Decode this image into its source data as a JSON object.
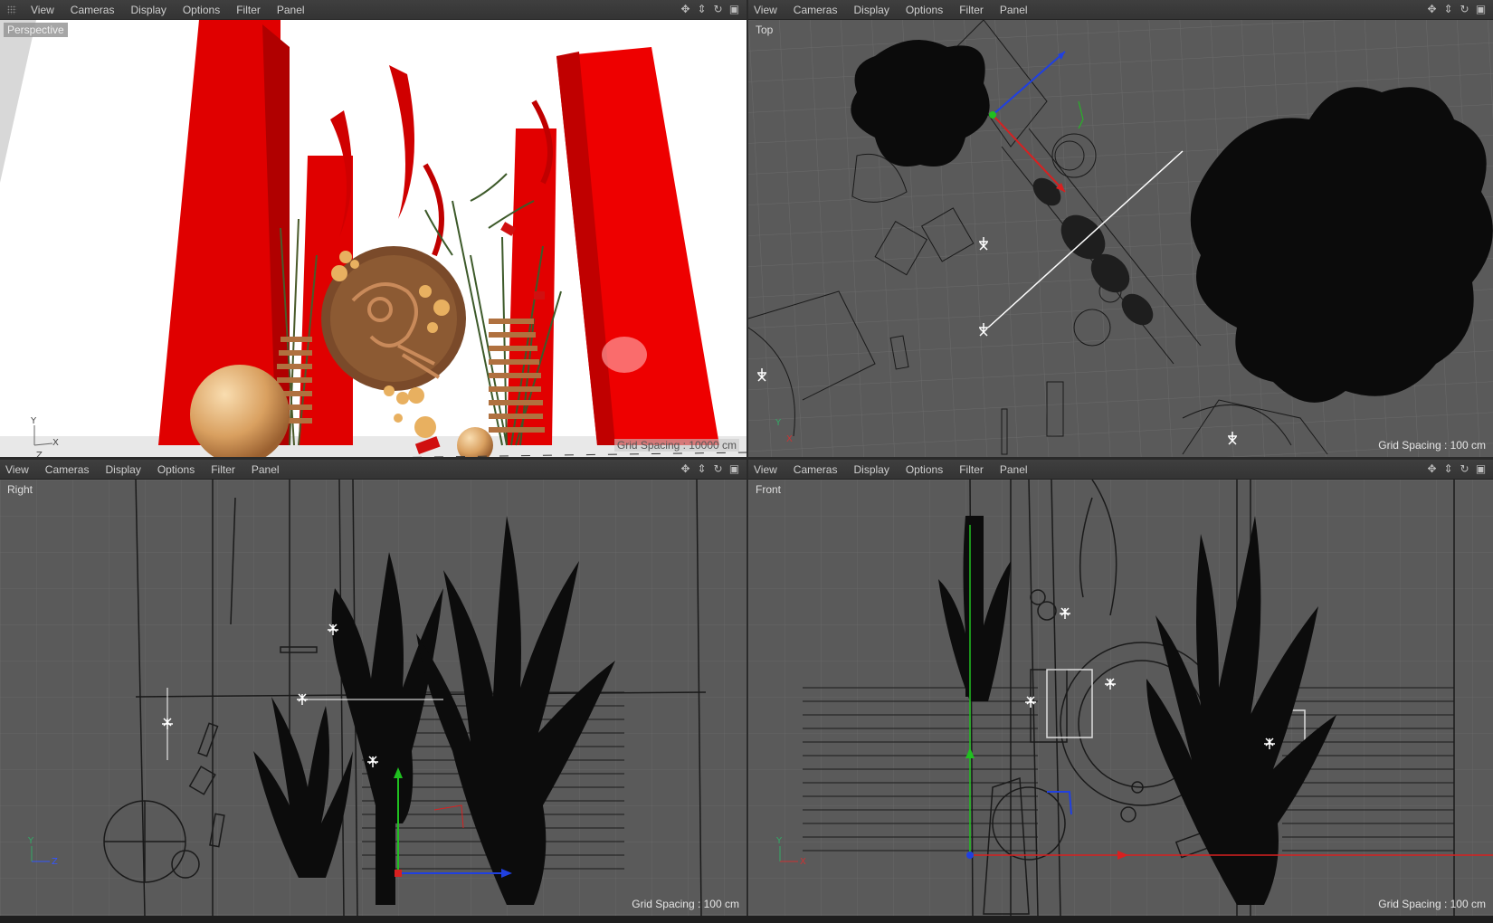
{
  "menu": [
    "View",
    "Cameras",
    "Display",
    "Options",
    "Filter",
    "Panel"
  ],
  "nav_icons": [
    "move-icon",
    "zoom-icon",
    "rotate-icon",
    "maximize-icon"
  ],
  "viewports": {
    "perspective": {
      "label": "Perspective",
      "grid": "Grid Spacing : 10000 cm"
    },
    "top": {
      "label": "Top",
      "grid": "Grid Spacing : 100 cm"
    },
    "right": {
      "label": "Right",
      "grid": "Grid Spacing : 100 cm"
    },
    "front": {
      "label": "Front",
      "grid": "Grid Spacing : 100 cm"
    }
  },
  "axes": {
    "x": "X",
    "y": "Y",
    "z": "Z"
  },
  "colors": {
    "viewport_bg": "#5a5a5a",
    "menubar_bg": "#3a3a3a",
    "accent_red": "#e01010",
    "axis_x": "#d82020",
    "axis_y": "#20c020",
    "axis_z": "#2040e0"
  }
}
